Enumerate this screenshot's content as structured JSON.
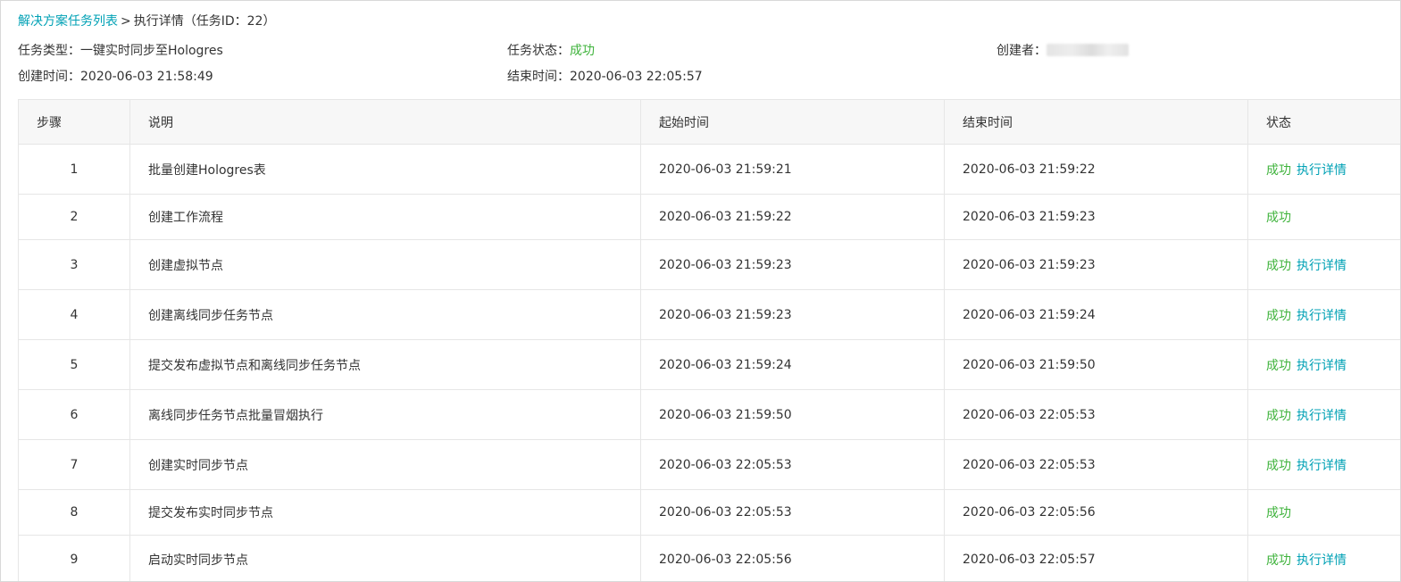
{
  "breadcrumb": {
    "parent_link": "解决方案任务列表",
    "separator": ">",
    "current": "执行详情（任务ID：22）"
  },
  "info": {
    "task_type_label": "任务类型：",
    "task_type_value": "一键实时同步至Hologres",
    "task_status_label": "任务状态：",
    "task_status_value": "成功",
    "creator_label": "创建者：",
    "create_time_label": "创建时间：",
    "create_time_value": "2020-06-03 21:58:49",
    "end_time_label": "结束时间：",
    "end_time_value": "2020-06-03 22:05:57"
  },
  "colors": {
    "link": "#00a1b5",
    "success": "#3fb33c",
    "header_bg": "#f7f7f7",
    "border": "#e6e6e6"
  },
  "table": {
    "headers": [
      "步骤",
      "说明",
      "起始时间",
      "结束时间",
      "状态"
    ],
    "detail_link_label": "执行详情",
    "rows": [
      {
        "step": "1",
        "desc": "批量创建Hologres表",
        "start": "2020-06-03 21:59:21",
        "end": "2020-06-03 21:59:22",
        "status": "成功",
        "has_detail": true
      },
      {
        "step": "2",
        "desc": "创建工作流程",
        "start": "2020-06-03 21:59:22",
        "end": "2020-06-03 21:59:23",
        "status": "成功",
        "has_detail": false
      },
      {
        "step": "3",
        "desc": "创建虚拟节点",
        "start": "2020-06-03 21:59:23",
        "end": "2020-06-03 21:59:23",
        "status": "成功",
        "has_detail": true
      },
      {
        "step": "4",
        "desc": "创建离线同步任务节点",
        "start": "2020-06-03 21:59:23",
        "end": "2020-06-03 21:59:24",
        "status": "成功",
        "has_detail": true
      },
      {
        "step": "5",
        "desc": "提交发布虚拟节点和离线同步任务节点",
        "start": "2020-06-03 21:59:24",
        "end": "2020-06-03 21:59:50",
        "status": "成功",
        "has_detail": true
      },
      {
        "step": "6",
        "desc": "离线同步任务节点批量冒烟执行",
        "start": "2020-06-03 21:59:50",
        "end": "2020-06-03 22:05:53",
        "status": "成功",
        "has_detail": true
      },
      {
        "step": "7",
        "desc": "创建实时同步节点",
        "start": "2020-06-03 22:05:53",
        "end": "2020-06-03 22:05:53",
        "status": "成功",
        "has_detail": true
      },
      {
        "step": "8",
        "desc": "提交发布实时同步节点",
        "start": "2020-06-03 22:05:53",
        "end": "2020-06-03 22:05:56",
        "status": "成功",
        "has_detail": false
      },
      {
        "step": "9",
        "desc": "启动实时同步节点",
        "start": "2020-06-03 22:05:56",
        "end": "2020-06-03 22:05:57",
        "status": "成功",
        "has_detail": true
      }
    ]
  }
}
